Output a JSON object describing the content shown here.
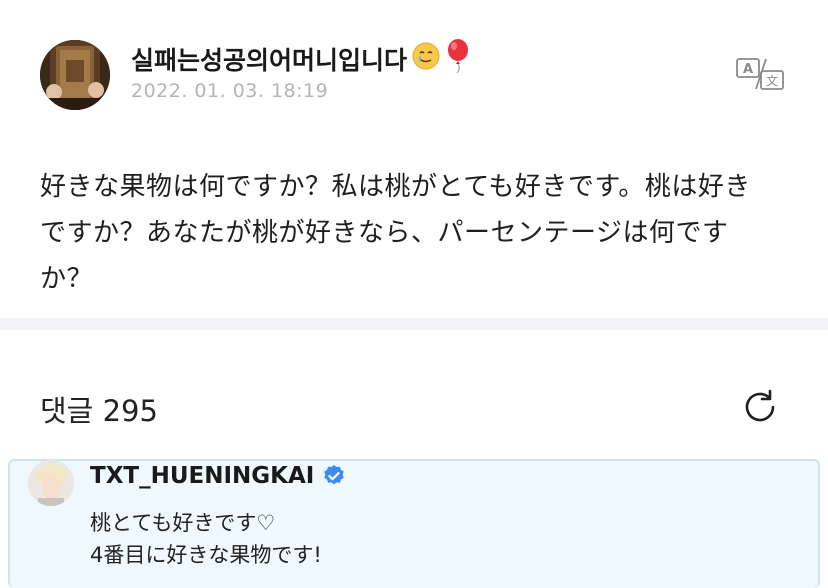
{
  "post": {
    "author": "실패는성공의어머니입니다",
    "author_emojis": [
      "🥲",
      "🎈"
    ],
    "date": "2022. 01. 03. 18:19",
    "body_lines": [
      "好きな果物は何ですか？私は桃がとても好きです。桃は好き",
      "ですか？あなたが桃が好きなら、パーセンテージは何です",
      "か？"
    ],
    "translate_label": "A 文"
  },
  "comments": {
    "label": "댓글",
    "count": "295",
    "items": [
      {
        "author": "TXT_HUENINGKAI",
        "verified": true,
        "lines": [
          "桃とても好きです♡",
          "4番目に好きな果物です!"
        ]
      }
    ]
  },
  "colors": {
    "date": "#b4b4b4",
    "divider": "#f3f3f5",
    "comment_bg": "#eef8fe",
    "comment_border": "#cfe4ee",
    "verified": "#3d8af7"
  },
  "icons": [
    "translate-icon",
    "refresh-icon",
    "verified-badge-icon"
  ]
}
